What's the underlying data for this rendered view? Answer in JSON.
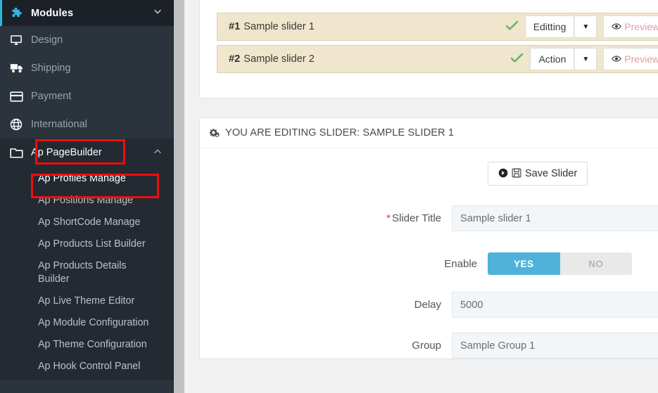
{
  "sidebar": {
    "header": {
      "label": "Modules",
      "icon": "puzzle-icon",
      "chevron": "chevron-down-icon"
    },
    "items": [
      {
        "label": "Design",
        "icon": "monitor-icon"
      },
      {
        "label": "Shipping",
        "icon": "truck-icon"
      },
      {
        "label": "Payment",
        "icon": "credit-card-icon"
      },
      {
        "label": "International",
        "icon": "globe-icon"
      },
      {
        "label": "Ap PageBuilder",
        "icon": "folder-icon",
        "active": true,
        "chevron": "chevron-up-icon"
      }
    ],
    "submenu": [
      {
        "label": "Ap Profiles Manage",
        "highlighted": true
      },
      {
        "label": "Ap Positions Manage"
      },
      {
        "label": "Ap ShortCode Manage"
      },
      {
        "label": "Ap Products List Builder"
      },
      {
        "label": "Ap Products Details Builder"
      },
      {
        "label": "Ap Live Theme Editor"
      },
      {
        "label": "Ap Module Configuration"
      },
      {
        "label": "Ap Theme Configuration"
      },
      {
        "label": "Ap Hook Control Panel"
      }
    ],
    "highlight_color": "#f20d0d"
  },
  "slider_list": {
    "rows": [
      {
        "num": "#1",
        "name": "Sample slider 1",
        "status_icon": "check-icon",
        "action_label": "Editting",
        "preview_label": "Preview",
        "preview_icon": "eye-icon"
      },
      {
        "num": "#2",
        "name": "Sample slider 2",
        "status_icon": "check-icon",
        "action_label": "Action",
        "preview_label": "Preview",
        "preview_icon": "eye-icon"
      }
    ]
  },
  "editing_panel": {
    "title": "YOU ARE EDITING SLIDER: SAMPLE SLIDER 1",
    "title_icon": "gears-icon",
    "save_button": {
      "label": "Save Slider",
      "icon": "floppy-disk-icon",
      "lead_icon": "arrow-right-circle-icon"
    },
    "fields": {
      "slider_title": {
        "label": "Slider Title",
        "required": true,
        "value": "Sample slider 1"
      },
      "enable": {
        "label": "Enable",
        "yes_label": "YES",
        "no_label": "NO",
        "selected": "YES"
      },
      "delay": {
        "label": "Delay",
        "value": "5000"
      },
      "group": {
        "label": "Group",
        "value": "Sample Group 1",
        "options": [
          "Sample Group 1"
        ]
      }
    }
  },
  "colors": {
    "sidebar_bg": "#2b333c",
    "sidebar_active_bg": "#232a31",
    "accent_blue": "#25b9d7",
    "toggle_on": "#4fb3d9",
    "row_bg": "#f0e6cd",
    "check_green": "#5fb65f",
    "preview_pink": "#e39ba2",
    "annotation_red": "#f20d0d"
  }
}
